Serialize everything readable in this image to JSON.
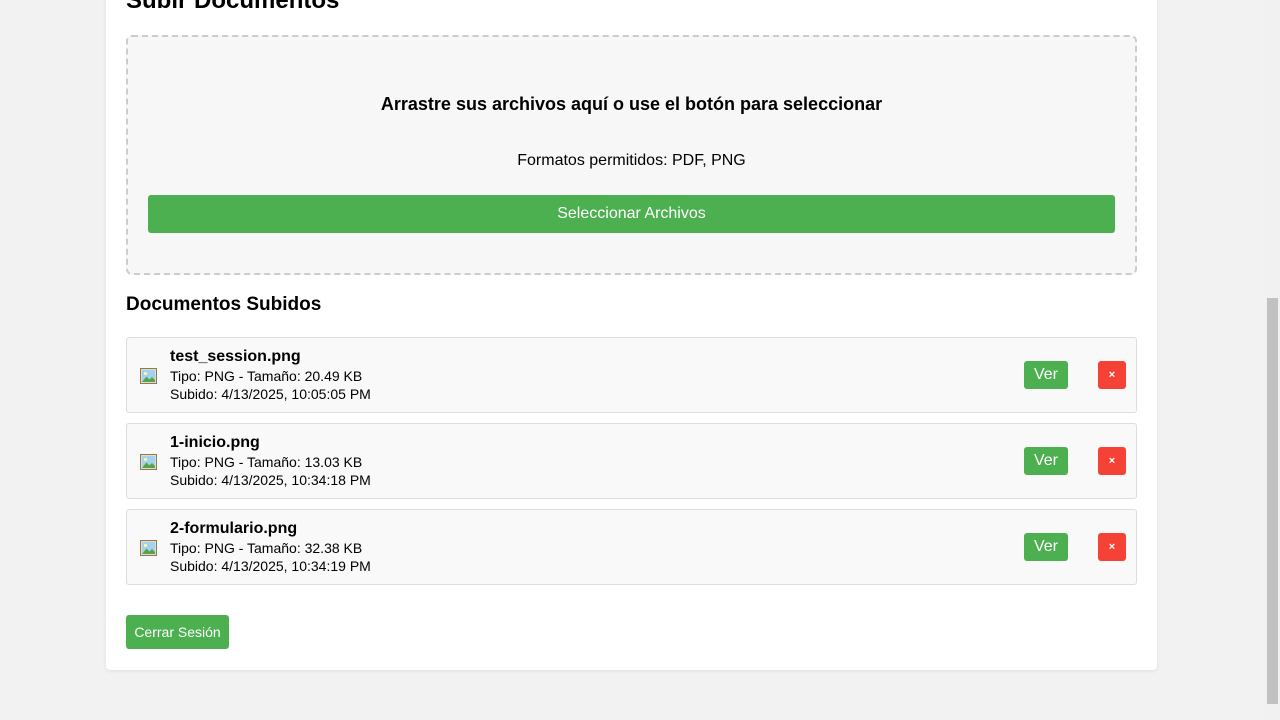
{
  "page": {
    "title": "Subir Documentos"
  },
  "dropzone": {
    "heading": "Arrastre sus archivos aquí o use el botón para seleccionar",
    "formats": "Formatos permitidos: PDF, PNG",
    "select_label": "Seleccionar Archivos"
  },
  "documents": {
    "section_title": "Documentos Subidos",
    "view_label": "Ver",
    "delete_label": "×",
    "items": [
      {
        "name": "test_session.png",
        "meta": "Tipo: PNG - Tamaño: 20.49 KB",
        "uploaded": "Subido: 4/13/2025, 10:05:05 PM",
        "icon": "image-file-icon"
      },
      {
        "name": "1-inicio.png",
        "meta": "Tipo: PNG - Tamaño: 13.03 KB",
        "uploaded": "Subido: 4/13/2025, 10:34:18 PM",
        "icon": "image-file-icon"
      },
      {
        "name": "2-formulario.png",
        "meta": "Tipo: PNG - Tamaño: 32.38 KB",
        "uploaded": "Subido: 4/13/2025, 10:34:19 PM",
        "icon": "image-file-icon"
      }
    ]
  },
  "footer": {
    "logout_label": "Cerrar Sesión"
  },
  "colors": {
    "accent": "#4caf50",
    "danger": "#f44336",
    "background": "#f2f2f2"
  }
}
